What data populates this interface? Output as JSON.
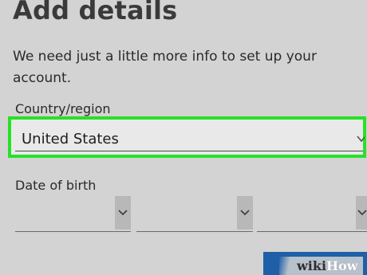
{
  "header": {
    "title": "Add details"
  },
  "description": "We need just a little more info to set up your account.",
  "country": {
    "label": "Country/region",
    "value": "United States",
    "chevron_icon": "chevron-down-icon",
    "highlight_color": "#27e127"
  },
  "dob": {
    "label": "Date of birth",
    "month_value": "",
    "day_value": "",
    "year_value": ""
  },
  "watermark": {
    "wiki": "wiki",
    "how": "How"
  },
  "colors": {
    "background": "#d3d3d3",
    "button": "#1f5fa8"
  }
}
